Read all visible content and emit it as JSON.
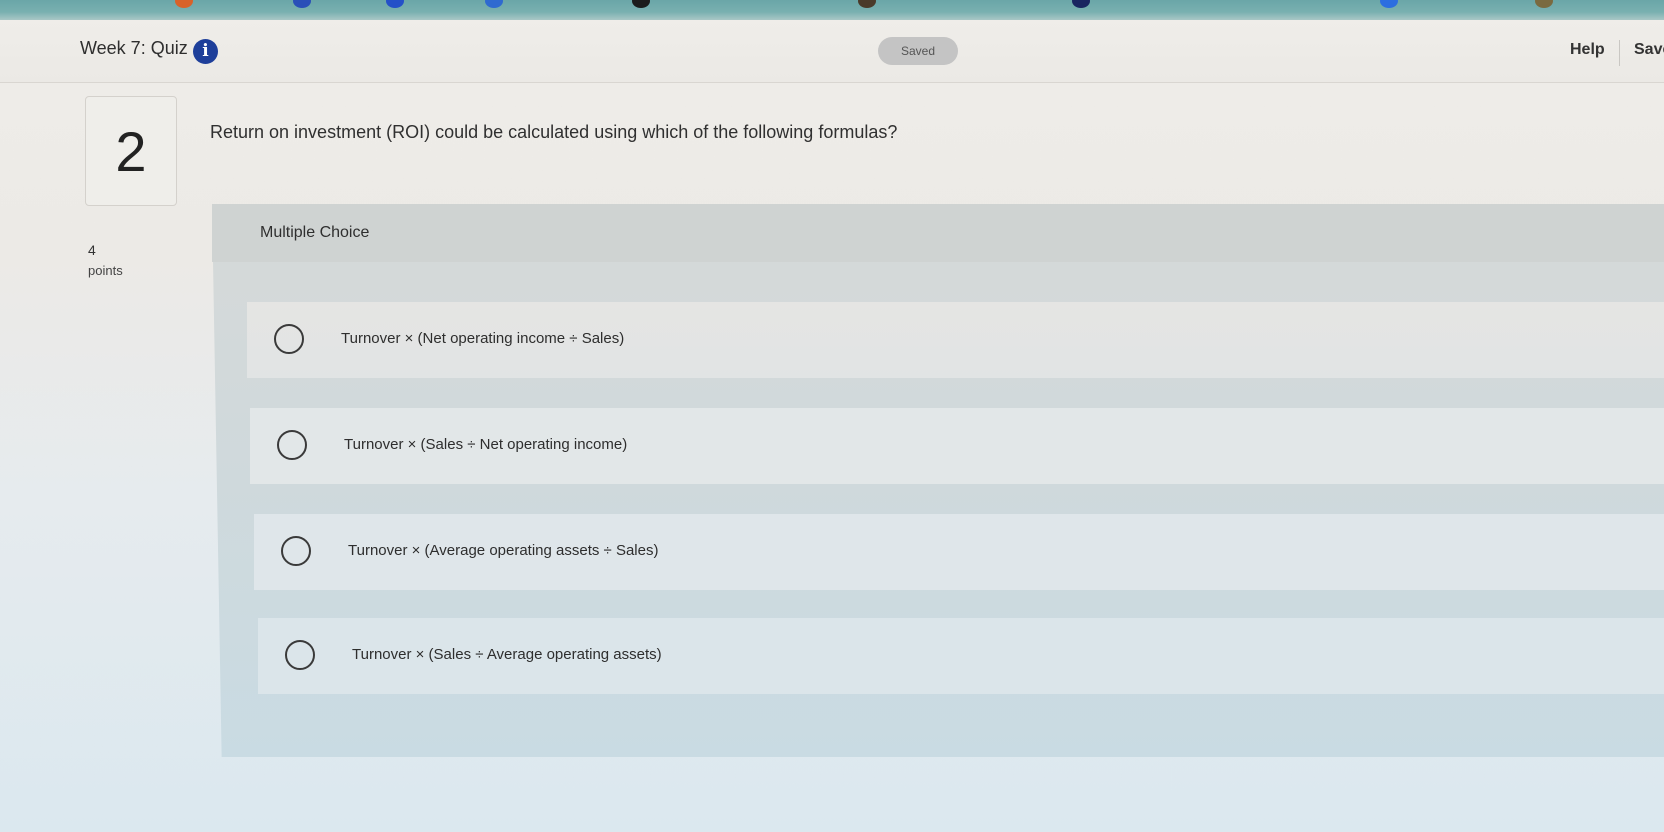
{
  "header": {
    "quiz_title": "Week 7: Quiz",
    "info_icon": "info-circle-icon",
    "status": "Saved",
    "help_label": "Help",
    "save_label": "Save"
  },
  "question": {
    "number": "2",
    "text": "Return on investment (ROI) could be calculated using which of the following formulas?",
    "points_value": "4",
    "points_label": "points",
    "type_label": "Multiple Choice",
    "options": [
      {
        "label": "Turnover × (Net operating income ÷ Sales)"
      },
      {
        "label": "Turnover × (Sales ÷ Net operating income)"
      },
      {
        "label": "Turnover × (Average operating assets ÷ Sales)"
      },
      {
        "label": "Turnover × (Sales ÷ Average operating assets)"
      }
    ]
  },
  "colors": {
    "info_icon_bg": "#1e3f9a",
    "saved_pill_bg": "#c4c4c4",
    "panel_bg": "#cfd9dc"
  }
}
